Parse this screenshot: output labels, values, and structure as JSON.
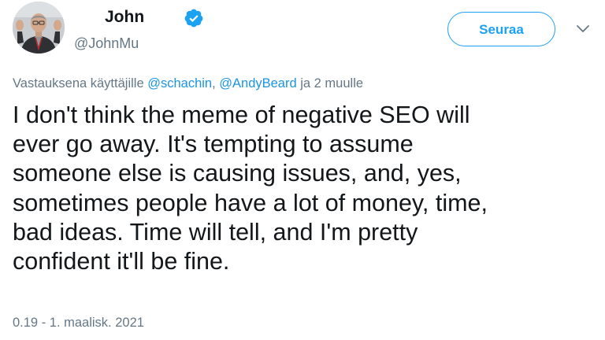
{
  "tweet": {
    "author": {
      "display_name": "John",
      "handle": "@JohnMu",
      "verified": true
    },
    "follow_label": "Seuraa",
    "reply_context": {
      "prefix": "Vastauksena käyttäjille ",
      "mention_1": "@schachin",
      "separator": ", ",
      "mention_2": "@AndyBeard",
      "suffix": " ja 2 muulle"
    },
    "text_lines": [
      "I don't think the meme of negative SEO will",
      "ever go away. It's tempting to assume",
      "someone else is causing issues, and, yes,",
      "sometimes people have a lot of money, time,",
      "bad ideas. Time will tell, and I'm pretty",
      "confident it'll be fine."
    ],
    "timestamp": "0.19 - 1. maalisk. 2021"
  },
  "colors": {
    "accent": "#1da1f2",
    "mention": "#1b95e0",
    "secondary_text": "#657786",
    "primary_text": "#14171a"
  },
  "icons": {
    "verified": "verified-badge-icon",
    "menu": "chevron-down-icon"
  }
}
